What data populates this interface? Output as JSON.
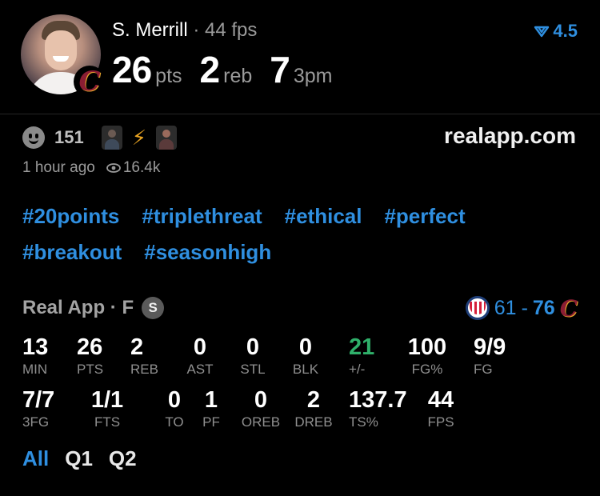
{
  "player": {
    "name": "S. Merrill",
    "separator": "·",
    "fps_label": "44 fps",
    "rating": "4.5",
    "stats": [
      {
        "value": "26",
        "unit": "pts"
      },
      {
        "value": "2",
        "unit": "reb"
      },
      {
        "value": "7",
        "unit": "3pm"
      }
    ]
  },
  "social": {
    "reaction_count": "151",
    "site": "realapp.com",
    "time_ago": "1 hour ago",
    "views": "16.4k"
  },
  "tags": [
    "#20points",
    "#triplethreat",
    "#ethical",
    "#perfect",
    "#breakout",
    "#seasonhigh"
  ],
  "game": {
    "title": "Real App · F",
    "badge": "S",
    "away_score": "61",
    "dash": "-",
    "home_score": "76"
  },
  "boxscore": {
    "row1": [
      {
        "value": "13",
        "label": "MIN"
      },
      {
        "value": "26",
        "label": "PTS"
      },
      {
        "value": "2",
        "label": "REB"
      },
      {
        "value": "0",
        "label": "AST"
      },
      {
        "value": "0",
        "label": "STL"
      },
      {
        "value": "0",
        "label": "BLK"
      },
      {
        "value": "21",
        "label": "+/-"
      },
      {
        "value": "100",
        "label": "FG%"
      },
      {
        "value": "9/9",
        "label": "FG"
      }
    ],
    "row2": [
      {
        "value": "7/7",
        "label": "3FG"
      },
      {
        "value": "1/1",
        "label": "FTS"
      },
      {
        "value": "0",
        "label": "TO"
      },
      {
        "value": "1",
        "label": "PF"
      },
      {
        "value": "0",
        "label": "OREB"
      },
      {
        "value": "2",
        "label": "DREB"
      },
      {
        "value": "137.7",
        "label": "TS%"
      },
      {
        "value": "44",
        "label": "FPS"
      }
    ]
  },
  "tabs": [
    "All",
    "Q1",
    "Q2"
  ],
  "colors": {
    "accent": "#2f8fe0",
    "positive": "#2fb06a",
    "muted": "#9a9a9a",
    "background": "#000000"
  }
}
